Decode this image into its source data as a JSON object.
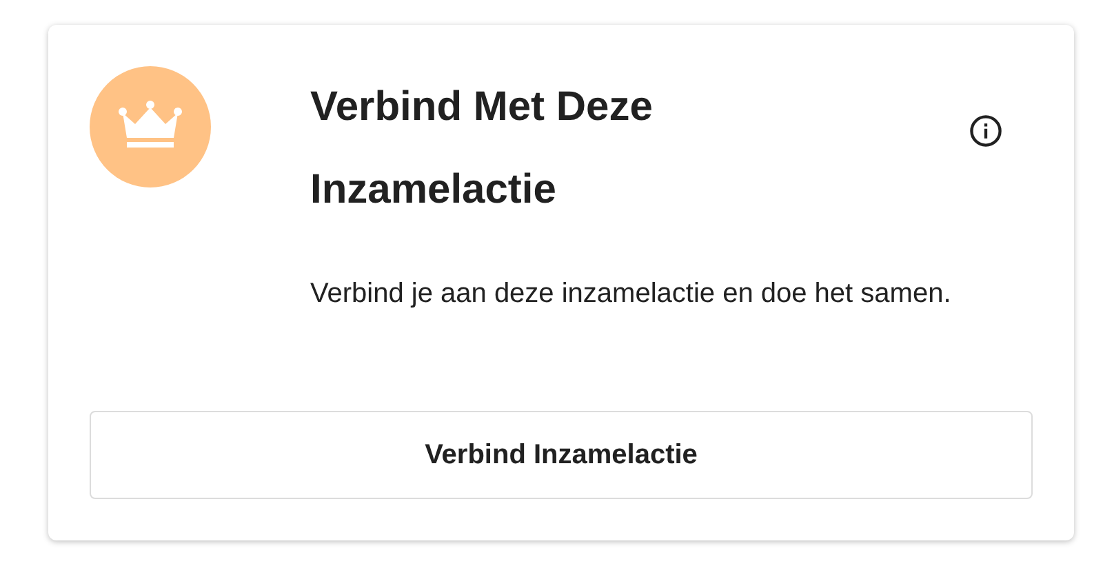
{
  "card": {
    "title": "Verbind Met Deze Inzamelactie",
    "description": "Verbind je aan deze inzamelactie en doe het samen.",
    "button": "Verbind Inzamelactie"
  }
}
